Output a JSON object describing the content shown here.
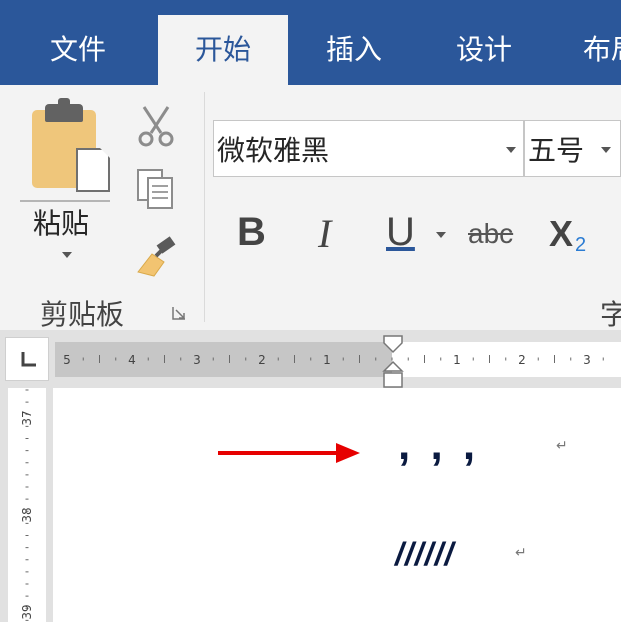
{
  "tabs": [
    {
      "label": "文件",
      "active": false
    },
    {
      "label": "开始",
      "active": true
    },
    {
      "label": "插入",
      "active": false
    },
    {
      "label": "设计",
      "active": false
    },
    {
      "label": "布局",
      "active": false
    }
  ],
  "clipboard": {
    "paste_label": "粘贴",
    "group_label": "剪贴板"
  },
  "font": {
    "name": "微软雅黑",
    "size": "五号",
    "bold": "B",
    "italic": "I",
    "underline": "U",
    "strikethrough": "abc",
    "subscript_base": "X",
    "subscript_sub": "2",
    "group_label_partial": "字"
  },
  "ruler": {
    "h_left_labels": [
      "5",
      "4",
      "3",
      "2",
      "1"
    ],
    "h_right_labels": [
      "1",
      "2",
      "3"
    ],
    "v_labels": [
      "37",
      "38",
      "39"
    ]
  },
  "document": {
    "line1": ", , ,",
    "line2": "//////",
    "paragraph_mark": "↵"
  },
  "colors": {
    "ribbon_blue": "#2b579a",
    "ribbon_bg": "#f3f3f3",
    "arrow_red": "#e60000",
    "subscript_blue": "#2b7cd3",
    "text_dark": "#0a1a40"
  }
}
